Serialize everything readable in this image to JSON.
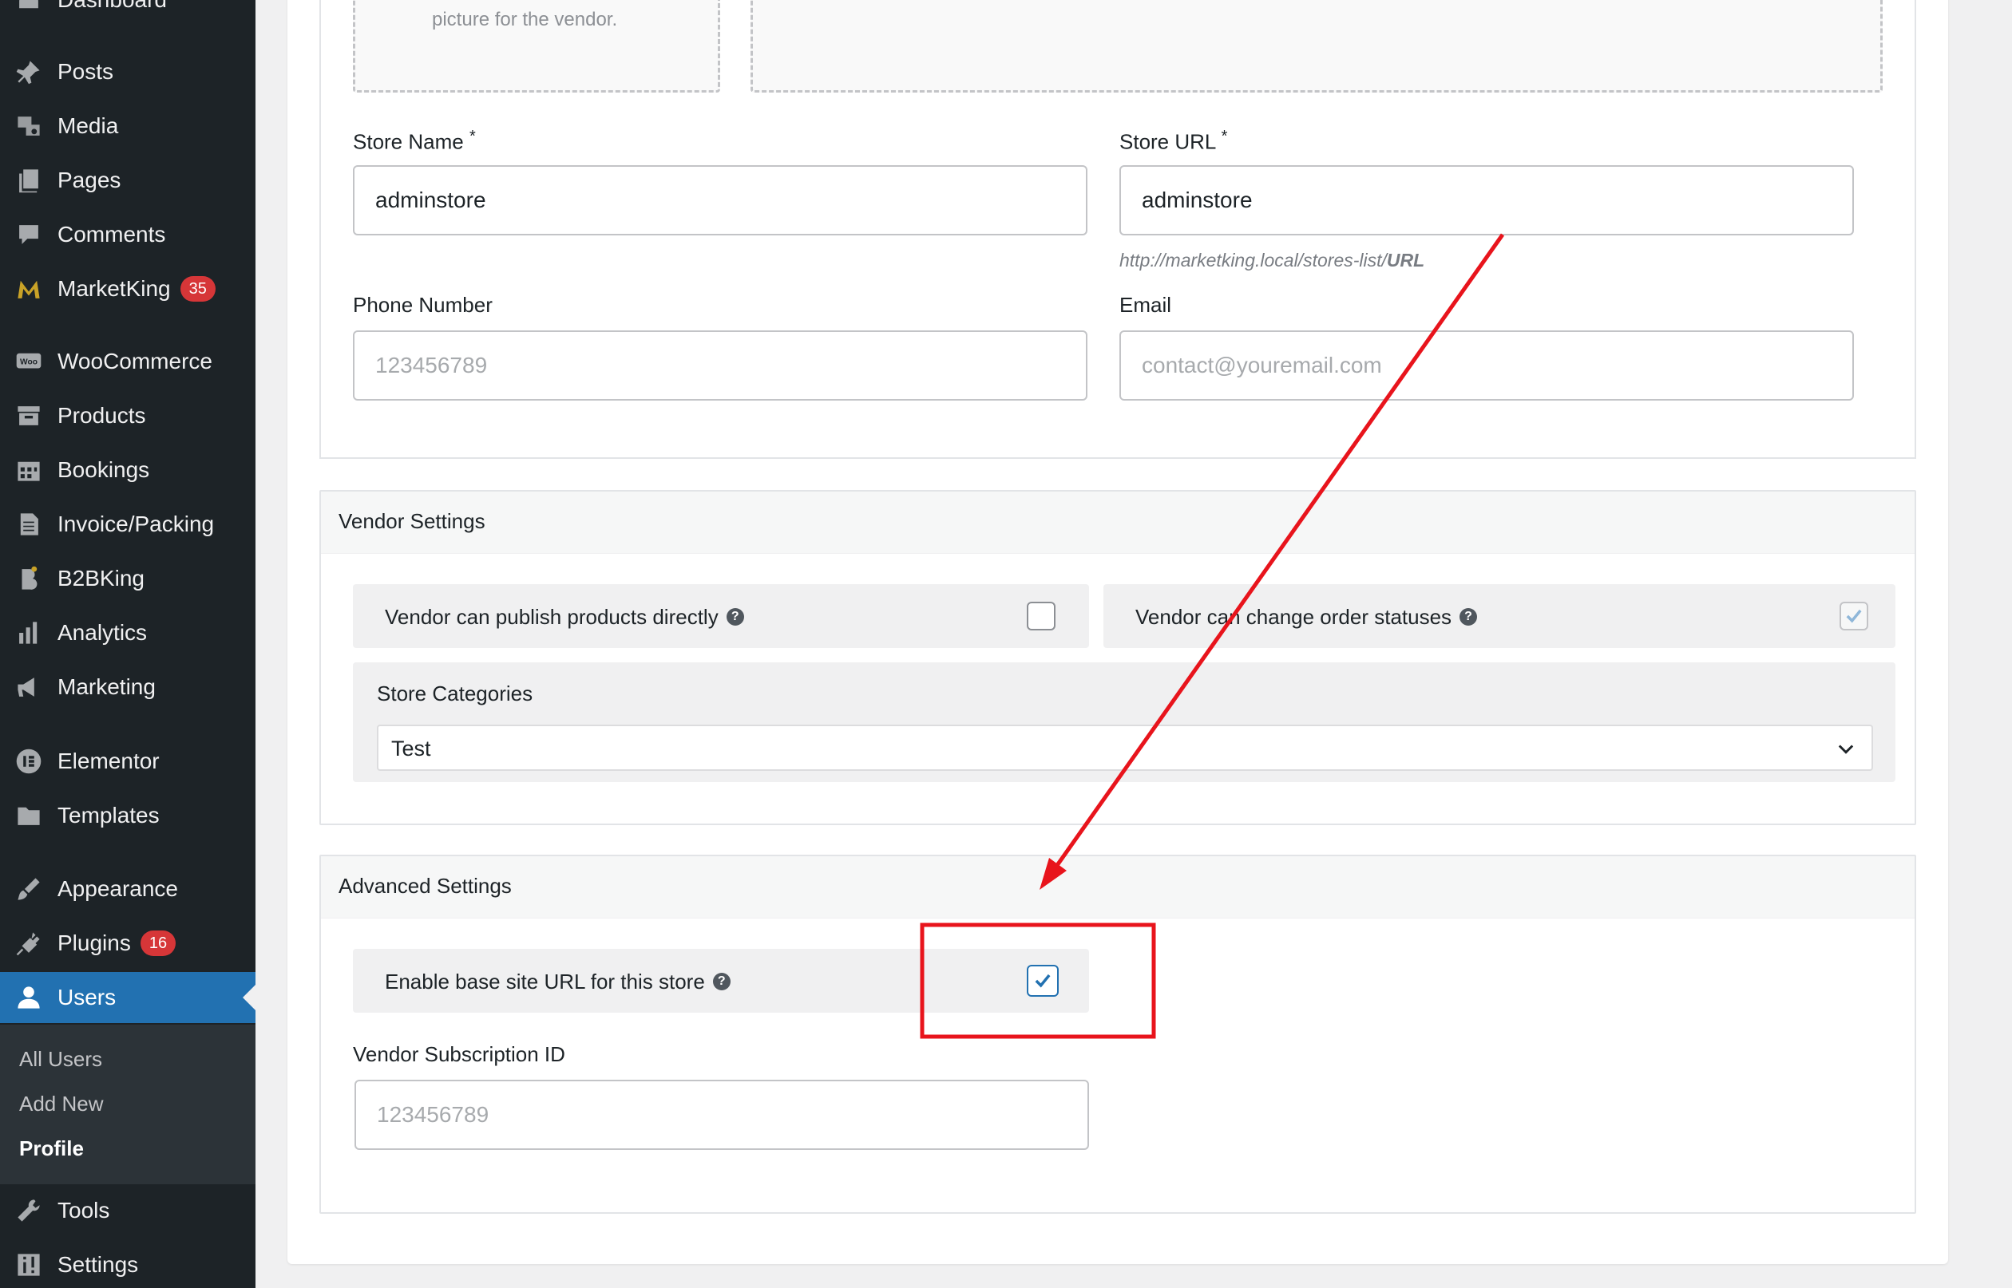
{
  "sidebar": {
    "items": [
      {
        "label": "Dashboard",
        "icon": "dashboard-icon"
      },
      {
        "label": "Posts",
        "icon": "pushpin-icon"
      },
      {
        "label": "Media",
        "icon": "media-icon"
      },
      {
        "label": "Pages",
        "icon": "pages-icon"
      },
      {
        "label": "Comments",
        "icon": "comment-icon"
      },
      {
        "label": "MarketKing",
        "icon": "marketking-logo-icon",
        "badge": "35"
      },
      {
        "label": "WooCommerce",
        "icon": "woo-icon"
      },
      {
        "label": "Products",
        "icon": "archive-icon"
      },
      {
        "label": "Bookings",
        "icon": "calendar-icon"
      },
      {
        "label": "Invoice/Packing",
        "icon": "document-icon"
      },
      {
        "label": "B2BKing",
        "icon": "b2bking-logo-icon"
      },
      {
        "label": "Analytics",
        "icon": "bar-chart-icon"
      },
      {
        "label": "Marketing",
        "icon": "megaphone-icon"
      },
      {
        "label": "Elementor",
        "icon": "elementor-icon"
      },
      {
        "label": "Templates",
        "icon": "folder-icon"
      },
      {
        "label": "Appearance",
        "icon": "paintbrush-icon"
      },
      {
        "label": "Plugins",
        "icon": "plug-icon",
        "badge": "16"
      },
      {
        "label": "Users",
        "icon": "user-icon"
      },
      {
        "label": "Tools",
        "icon": "wrench-icon"
      },
      {
        "label": "Settings",
        "icon": "sliders-icon"
      }
    ],
    "users_submenu": [
      "All Users",
      "Add New",
      "Profile"
    ]
  },
  "store": {
    "picture_hint": "picture for the vendor.",
    "store_name_label": "Store Name",
    "store_name_value": "adminstore",
    "store_url_label": "Store URL",
    "store_url_value": "adminstore",
    "required_mark": "*",
    "url_hint_prefix": "http://marketking.local/stores-list/",
    "url_hint_suffix": "URL",
    "phone_label": "Phone Number",
    "phone_placeholder": "123456789",
    "email_label": "Email",
    "email_placeholder": "contact@youremail.com"
  },
  "vendor_settings": {
    "title": "Vendor Settings",
    "publish_label": "Vendor can publish products directly",
    "publish_checked": false,
    "order_status_label": "Vendor can change order statuses",
    "order_status_checked": true,
    "categories_label": "Store Categories",
    "categories_value": "Test"
  },
  "advanced_settings": {
    "title": "Advanced Settings",
    "base_url_label": "Enable base site URL for this store",
    "base_url_checked": true,
    "subscription_label": "Vendor Subscription ID",
    "subscription_placeholder": "123456789"
  },
  "help_glyph": "?",
  "colors": {
    "sidebar_bg": "#1d2327",
    "active_blue": "#2271b1",
    "badge_red": "#d63638",
    "annotation_red": "#e8141c"
  }
}
